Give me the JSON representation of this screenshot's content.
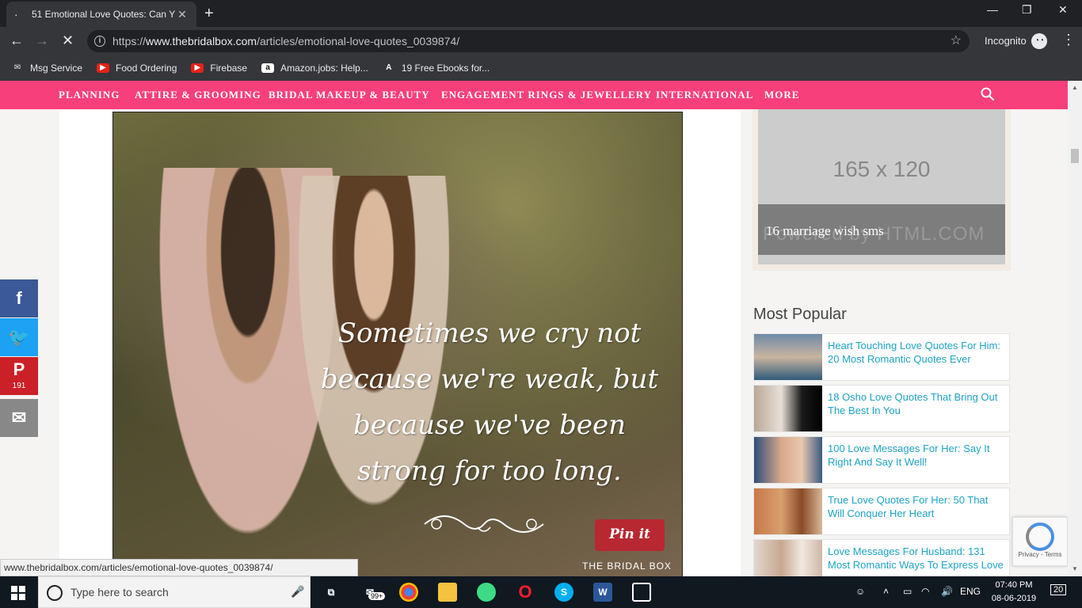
{
  "browser": {
    "tab_title": "51 Emotional Love Quotes: Can Y",
    "tab_close": "✕",
    "new_tab": "+",
    "url_prefix": "https://",
    "url_domain": "www.thebridalbox.com",
    "url_path": "/articles/emotional-love-quotes_0039874/",
    "incognito_label": "Incognito",
    "minimize": "—",
    "maximize": "❐",
    "close": "✕",
    "back": "←",
    "forward": "→",
    "stop": "✕",
    "star": "☆",
    "menu": "⋮"
  },
  "bookmarks": [
    {
      "label": "Msg Service",
      "icon": "mail-icon"
    },
    {
      "label": "Food Ordering",
      "icon": "youtube-icon"
    },
    {
      "label": "Firebase",
      "icon": "youtube-icon"
    },
    {
      "label": "Amazon.jobs: Help...",
      "icon": "amazon-icon"
    },
    {
      "label": "19 Free Ebooks for...",
      "icon": "ebook-icon"
    }
  ],
  "nav": {
    "items": [
      "PLANNING",
      "ATTIRE & GROOMING",
      "BRIDAL MAKEUP & BEAUTY",
      "ENGAGEMENT RINGS & JEWELLERY",
      "INTERNATIONAL",
      "MORE"
    ],
    "accent": "#f73f7b"
  },
  "article": {
    "quote": "Sometimes we cry not because we're weak, but because we've been strong for too long.",
    "pin_label": "Pin it",
    "brand": "THE BRIDAL BOX"
  },
  "ad": {
    "size_label": "165 x 120",
    "watermark": "Powered by HTML.COM",
    "caption": "16 marriage wish sms"
  },
  "most_popular": {
    "title": "Most Popular",
    "items": [
      "Heart Touching Love Quotes For Him: 20 Most Romantic Quotes Ever",
      "18 Osho Love Quotes That Bring Out The Best In You",
      "100 Love Messages For Her: Say It Right And Say It Well!",
      "True Love Quotes For Her: 50 That Will Conquer Her Heart",
      "Love Messages For Husband: 131 Most Romantic Ways To Express Love"
    ]
  },
  "social": {
    "facebook": "f",
    "twitter": "🐦",
    "pinterest": "P",
    "pinterest_count": "191",
    "email": "✉"
  },
  "status_url": "www.thebridalbox.com/articles/emotional-love-quotes_0039874/",
  "recaptcha": {
    "links": "Privacy - Terms"
  },
  "taskbar": {
    "search_placeholder": "Type here to search",
    "badge": "99+",
    "lang": "ENG",
    "time": "07:40 PM",
    "date": "08-06-2019",
    "notifications": "20"
  }
}
